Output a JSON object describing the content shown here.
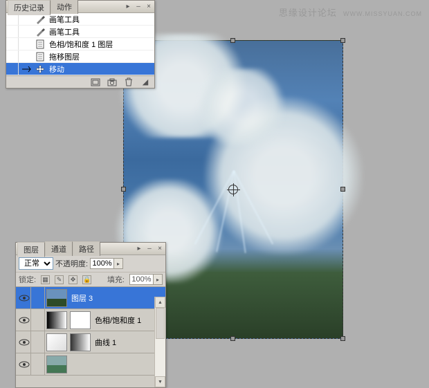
{
  "watermark": {
    "site_cn": "思缘设计论坛",
    "url": "WWW.MISSYUAN.COM"
  },
  "history": {
    "tabs": {
      "history": "历史记录",
      "actions": "动作"
    },
    "items": [
      {
        "label": "画笔工具",
        "icon": "brush"
      },
      {
        "label": "画笔工具",
        "icon": "brush"
      },
      {
        "label": "色相/饱和度 1 图层",
        "icon": "page"
      },
      {
        "label": "拖移图层",
        "icon": "page"
      },
      {
        "label": "移动",
        "icon": "move",
        "selected": true
      }
    ],
    "footer_icons": [
      "new-doc",
      "snapshot",
      "trash"
    ]
  },
  "layers": {
    "tabs": {
      "layers": "图层",
      "channels": "通道",
      "paths": "路径"
    },
    "blend_mode": "正常",
    "opacity_label": "不透明度:",
    "opacity_value": "100%",
    "lock_label": "锁定:",
    "fill_label": "填充:",
    "fill_value": "100%",
    "items": [
      {
        "name": "图层 3",
        "thumb": "sky",
        "selected": true
      },
      {
        "name": "色相/饱和度 1",
        "thumb": "grad",
        "mask": true
      },
      {
        "name": "曲线 1",
        "thumb": "curve",
        "mask": true
      }
    ]
  }
}
